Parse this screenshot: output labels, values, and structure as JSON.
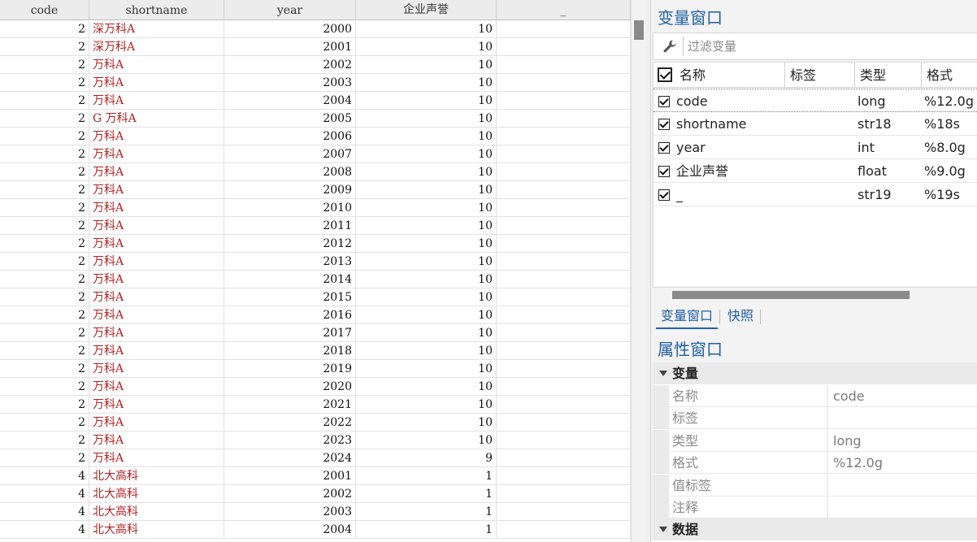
{
  "grid": {
    "columns": [
      "code",
      "shortname",
      "year",
      "企业声誉",
      "_"
    ],
    "rows": [
      [
        "2",
        "深万科A",
        "2000",
        "10",
        ""
      ],
      [
        "2",
        "深万科A",
        "2001",
        "10",
        ""
      ],
      [
        "2",
        "万科A",
        "2002",
        "10",
        ""
      ],
      [
        "2",
        "万科A",
        "2003",
        "10",
        ""
      ],
      [
        "2",
        "万科A",
        "2004",
        "10",
        ""
      ],
      [
        "2",
        "G 万科A",
        "2005",
        "10",
        ""
      ],
      [
        "2",
        "万科A",
        "2006",
        "10",
        ""
      ],
      [
        "2",
        "万科A",
        "2007",
        "10",
        ""
      ],
      [
        "2",
        "万科A",
        "2008",
        "10",
        ""
      ],
      [
        "2",
        "万科A",
        "2009",
        "10",
        ""
      ],
      [
        "2",
        "万科A",
        "2010",
        "10",
        ""
      ],
      [
        "2",
        "万科A",
        "2011",
        "10",
        ""
      ],
      [
        "2",
        "万科A",
        "2012",
        "10",
        ""
      ],
      [
        "2",
        "万科A",
        "2013",
        "10",
        ""
      ],
      [
        "2",
        "万科A",
        "2014",
        "10",
        ""
      ],
      [
        "2",
        "万科A",
        "2015",
        "10",
        ""
      ],
      [
        "2",
        "万科A",
        "2016",
        "10",
        ""
      ],
      [
        "2",
        "万科A",
        "2017",
        "10",
        ""
      ],
      [
        "2",
        "万科A",
        "2018",
        "10",
        ""
      ],
      [
        "2",
        "万科A",
        "2019",
        "10",
        ""
      ],
      [
        "2",
        "万科A",
        "2020",
        "10",
        ""
      ],
      [
        "2",
        "万科A",
        "2021",
        "10",
        ""
      ],
      [
        "2",
        "万科A",
        "2022",
        "10",
        ""
      ],
      [
        "2",
        "万科A",
        "2023",
        "10",
        ""
      ],
      [
        "2",
        "万科A",
        "2024",
        "9",
        ""
      ],
      [
        "4",
        "北大高科",
        "2001",
        "1",
        ""
      ],
      [
        "4",
        "北大高科",
        "2002",
        "1",
        ""
      ],
      [
        "4",
        "北大高科",
        "2003",
        "1",
        ""
      ],
      [
        "4",
        "北大高科",
        "2004",
        "1",
        ""
      ]
    ]
  },
  "variables_panel": {
    "title": "变量窗口",
    "filter_placeholder": "过滤变量",
    "filter_icon": "wrench-icon",
    "headers": [
      "名称",
      "标签",
      "类型",
      "格式"
    ],
    "variables": [
      {
        "name": "code",
        "label": "",
        "type": "long",
        "format": "%12.0g",
        "checked": true
      },
      {
        "name": "shortname",
        "label": "",
        "type": "str18",
        "format": "%18s",
        "checked": true
      },
      {
        "name": "year",
        "label": "",
        "type": "int",
        "format": "%8.0g",
        "checked": true
      },
      {
        "name": "企业声誉",
        "label": "",
        "type": "float",
        "format": "%9.0g",
        "checked": true
      },
      {
        "name": "_",
        "label": "",
        "type": "str19",
        "format": "%19s",
        "checked": true
      }
    ],
    "tabs": [
      "变量窗口",
      "快照"
    ]
  },
  "properties_panel": {
    "title": "属性窗口",
    "sections": [
      {
        "name": "变量",
        "rows": [
          {
            "key": "名称",
            "value": "code"
          },
          {
            "key": "标签",
            "value": ""
          },
          {
            "key": "类型",
            "value": "long"
          },
          {
            "key": "格式",
            "value": "%12.0g"
          },
          {
            "key": "值标签",
            "value": ""
          },
          {
            "key": "注释",
            "value": ""
          }
        ]
      },
      {
        "name": "数据",
        "rows": []
      }
    ]
  },
  "colors": {
    "accent": "#1f5fa6",
    "string_text": "#b22222"
  }
}
